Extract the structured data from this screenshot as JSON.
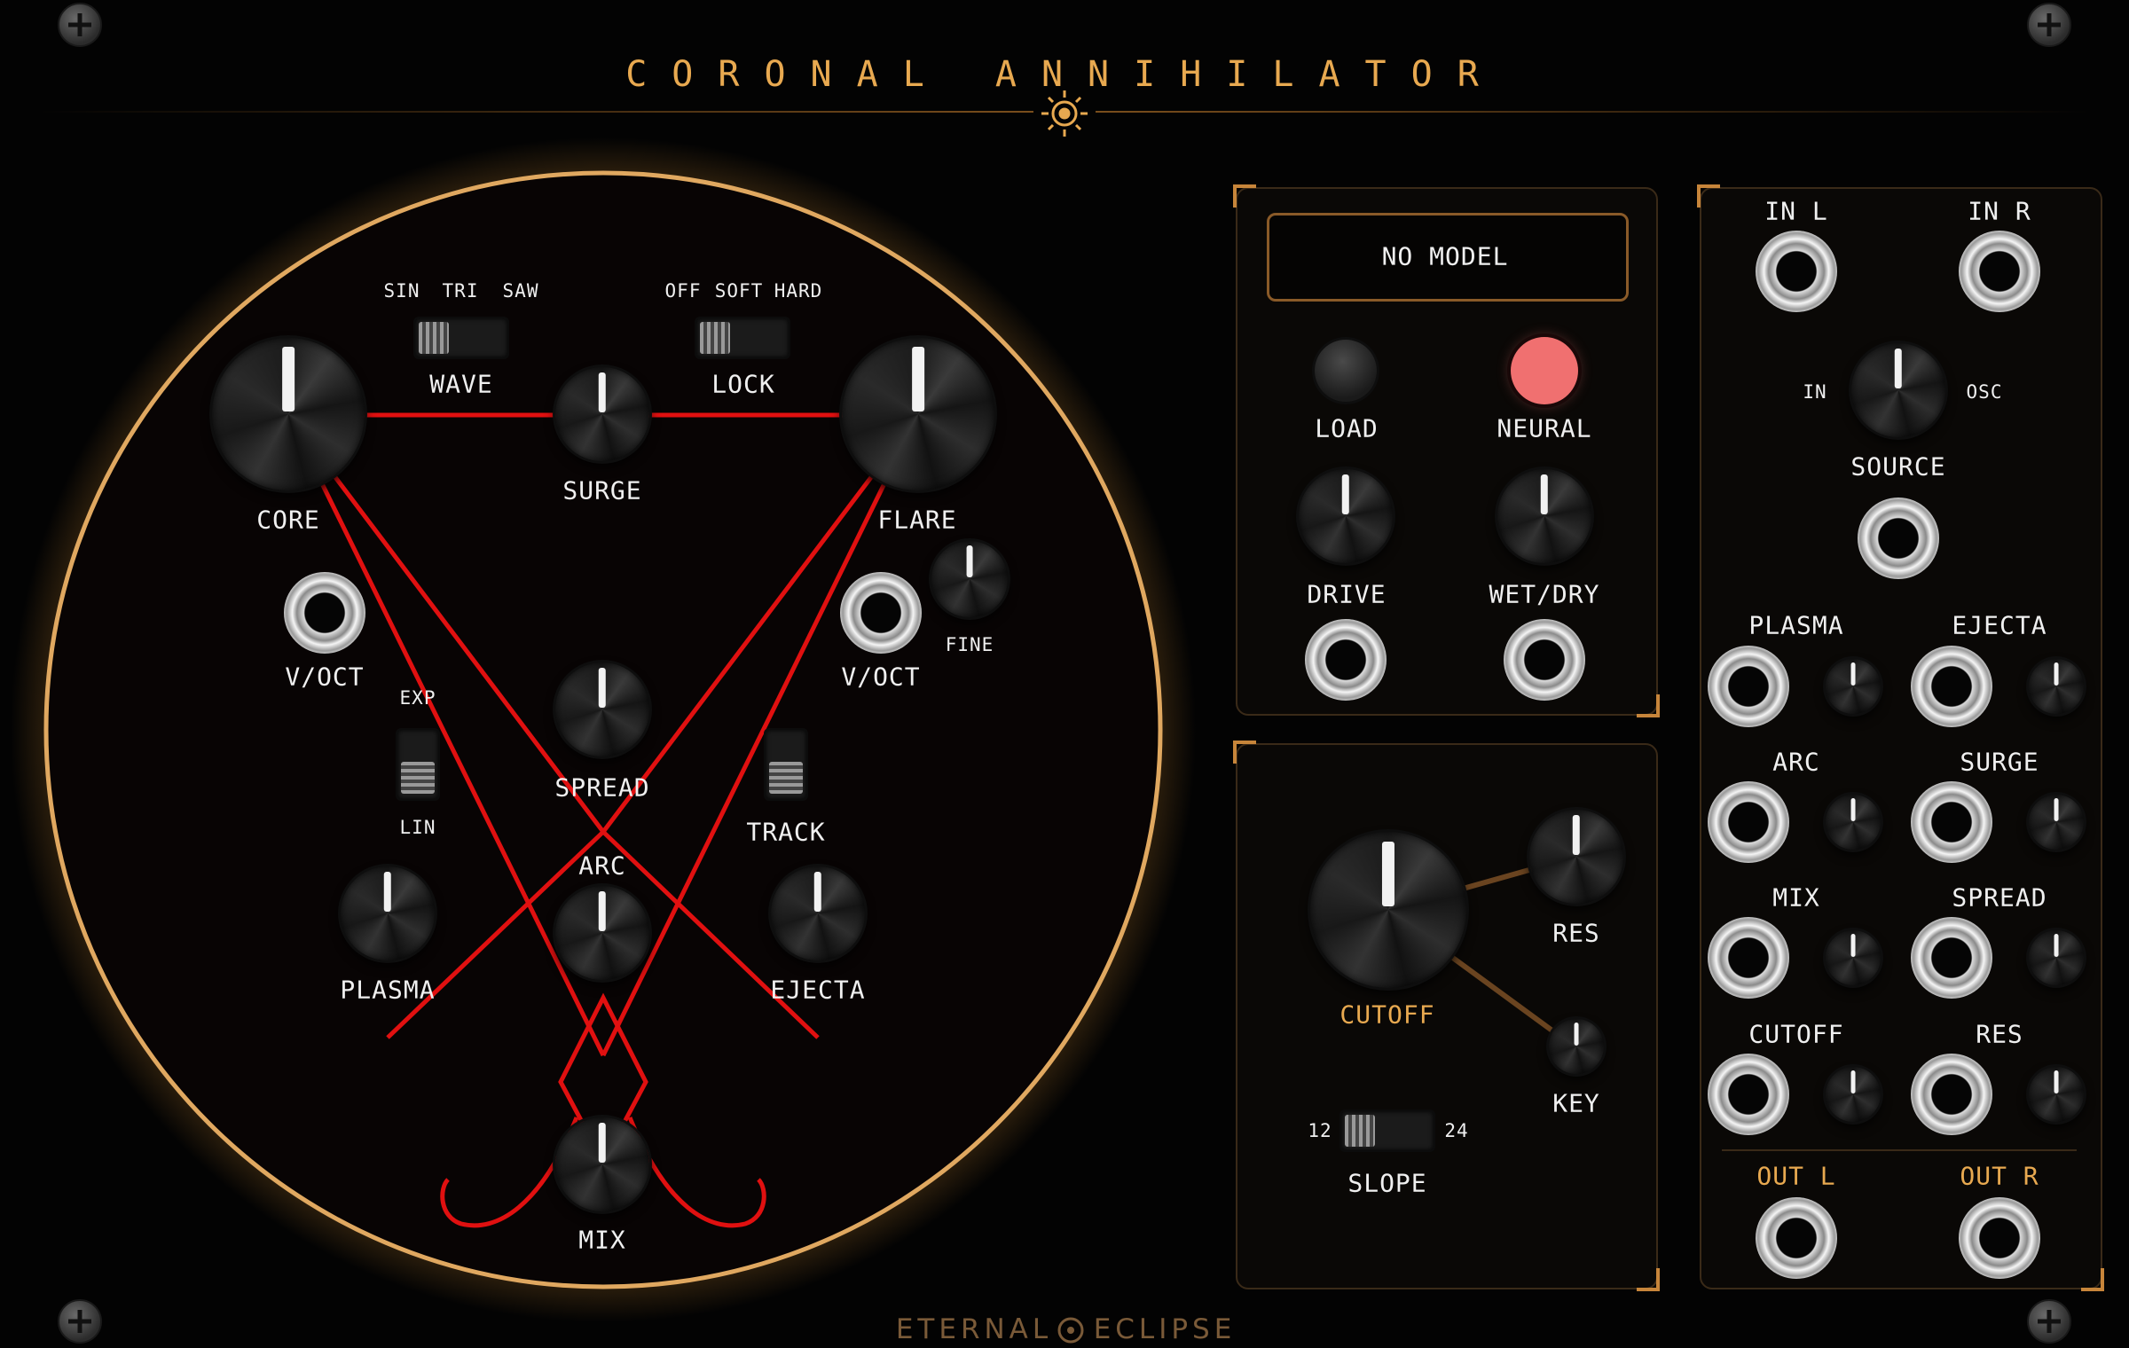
{
  "brand": {
    "title": "CORONAL ANNIHILATOR",
    "maker": "ETERNAL",
    "maker2": "ECLIPSE",
    "accent": "#e8a950",
    "line_color": "#e01010"
  },
  "main": {
    "wave": {
      "label": "WAVE",
      "options": [
        "SIN",
        "TRI",
        "SAW"
      ]
    },
    "lock": {
      "label": "LOCK",
      "options": [
        "OFF",
        "SOFT",
        "HARD"
      ]
    },
    "knobs": {
      "core": "CORE",
      "surge": "SURGE",
      "flare": "FLARE",
      "spread": "SPREAD",
      "arc": "ARC",
      "plasma": "PLASMA",
      "ejecta": "EJECTA",
      "mix": "MIX",
      "fine": "FINE"
    },
    "voct_left": "V/OCT",
    "voct_right": "V/OCT",
    "mode": {
      "top": "EXP",
      "bottom": "LIN"
    },
    "track": "TRACK"
  },
  "neural": {
    "display": "NO MODEL",
    "load": "LOAD",
    "neural": "NEURAL",
    "drive": "DRIVE",
    "wetdry": "WET/DRY",
    "neural_color": "#f07070"
  },
  "filter": {
    "cutoff": "CUTOFF",
    "res": "RES",
    "key": "KEY",
    "slope": "SLOPE",
    "slope_low": "12",
    "slope_high": "24"
  },
  "io": {
    "in_l": "IN L",
    "in_r": "IN R",
    "source": {
      "label": "SOURCE",
      "left": "IN",
      "right": "OSC"
    },
    "cv": [
      "PLASMA",
      "EJECTA",
      "ARC",
      "SURGE",
      "MIX",
      "SPREAD",
      "CUTOFF",
      "RES"
    ],
    "out_l": "OUT L",
    "out_r": "OUT R"
  }
}
